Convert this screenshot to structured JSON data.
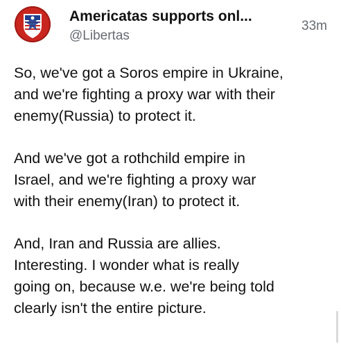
{
  "post": {
    "author": {
      "display_name": "Americatas supports onl...",
      "handle": "@Libertas",
      "avatar_icon": "eagle-shield-icon"
    },
    "timestamp": "33m",
    "paragraphs": [
      "So, we've got a Soros empire in Ukraine,\nand we're fighting a proxy war with their\nenemy(Russia) to protect it.",
      "And we've got a rothchild empire in\nIsrael, and we're fighting a proxy war\nwith their enemy(Iran) to protect it.",
      "And, Iran and Russia are allies.\nInteresting. I wonder what is really\ngoing on, because w.e. we're being told\nclearly isn't the entire picture."
    ]
  },
  "colors": {
    "text": "#111111",
    "muted": "#666b70",
    "avatar_red": "#c8261f",
    "avatar_blue": "#1f3f8f"
  }
}
